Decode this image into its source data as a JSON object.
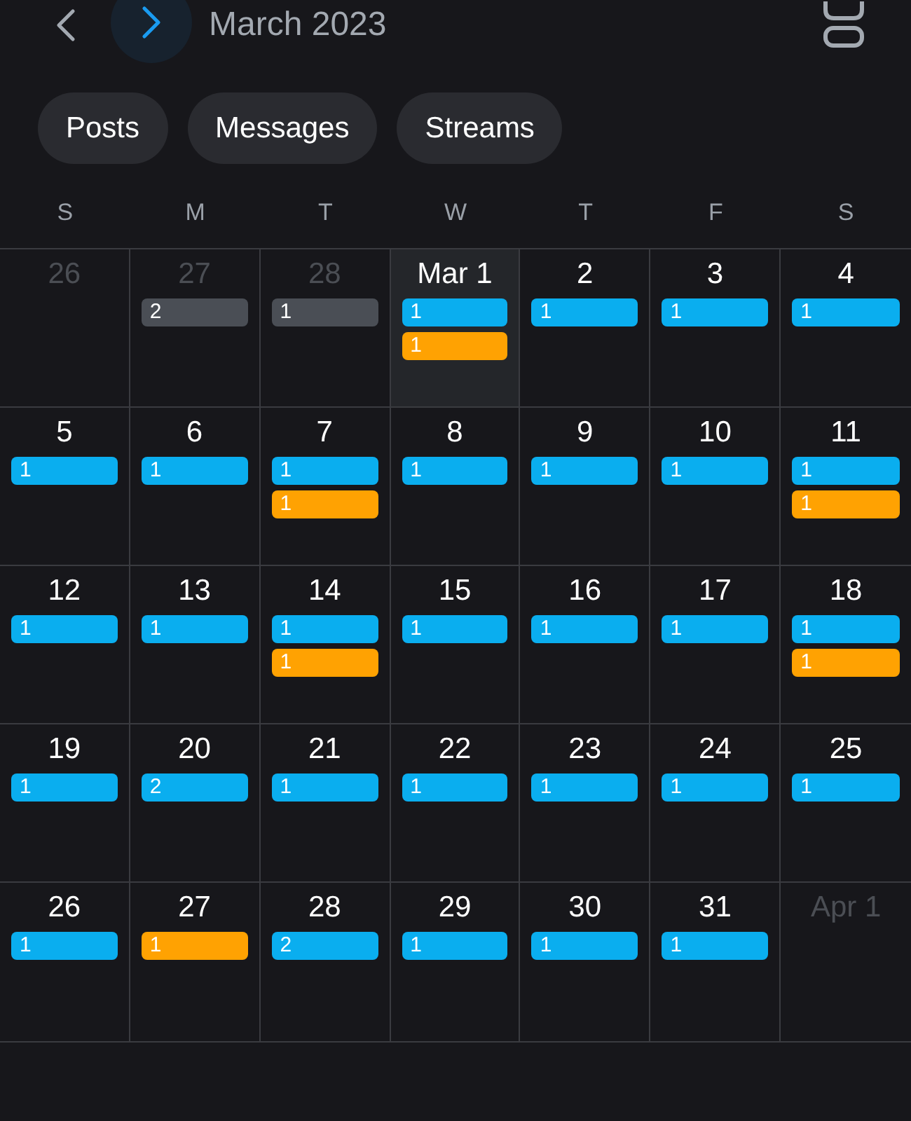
{
  "header": {
    "title": "March 2023"
  },
  "filters": [
    {
      "label": "Posts"
    },
    {
      "label": "Messages"
    },
    {
      "label": "Streams"
    }
  ],
  "weekdays": [
    "S",
    "M",
    "T",
    "W",
    "T",
    "F",
    "S"
  ],
  "weeks": [
    {
      "days": [
        {
          "label": "26",
          "in_month": false,
          "selected": false
        },
        {
          "label": "27",
          "in_month": false,
          "selected": false,
          "events": [
            {
              "count": "2",
              "color": "#4a4e55"
            }
          ]
        },
        {
          "label": "28",
          "in_month": false,
          "selected": false,
          "events": [
            {
              "count": "1",
              "color": "#4a4e55"
            }
          ]
        },
        {
          "label": "Mar 1",
          "in_month": true,
          "selected": true,
          "events": [
            {
              "count": "1",
              "color": "#0aaeef"
            },
            {
              "count": "1",
              "color": "#ffa202"
            }
          ]
        },
        {
          "label": "2",
          "in_month": true,
          "selected": false,
          "events": [
            {
              "count": "1",
              "color": "#0aaeef"
            }
          ]
        },
        {
          "label": "3",
          "in_month": true,
          "selected": false,
          "events": [
            {
              "count": "1",
              "color": "#0aaeef"
            }
          ]
        },
        {
          "label": "4",
          "in_month": true,
          "selected": false,
          "events": [
            {
              "count": "1",
              "color": "#0aaeef"
            }
          ]
        }
      ]
    },
    {
      "days": [
        {
          "label": "5",
          "in_month": true,
          "selected": false,
          "events": [
            {
              "count": "1",
              "color": "#0aaeef"
            }
          ]
        },
        {
          "label": "6",
          "in_month": true,
          "selected": false,
          "events": [
            {
              "count": "1",
              "color": "#0aaeef"
            }
          ]
        },
        {
          "label": "7",
          "in_month": true,
          "selected": false,
          "events": [
            {
              "count": "1",
              "color": "#0aaeef"
            },
            {
              "count": "1",
              "color": "#ffa202"
            }
          ]
        },
        {
          "label": "8",
          "in_month": true,
          "selected": false,
          "events": [
            {
              "count": "1",
              "color": "#0aaeef"
            }
          ]
        },
        {
          "label": "9",
          "in_month": true,
          "selected": false,
          "events": [
            {
              "count": "1",
              "color": "#0aaeef"
            }
          ]
        },
        {
          "label": "10",
          "in_month": true,
          "selected": false,
          "events": [
            {
              "count": "1",
              "color": "#0aaeef"
            }
          ]
        },
        {
          "label": "11",
          "in_month": true,
          "selected": false,
          "events": [
            {
              "count": "1",
              "color": "#0aaeef"
            },
            {
              "count": "1",
              "color": "#ffa202"
            }
          ]
        }
      ]
    },
    {
      "days": [
        {
          "label": "12",
          "in_month": true,
          "selected": false,
          "events": [
            {
              "count": "1",
              "color": "#0aaeef"
            }
          ]
        },
        {
          "label": "13",
          "in_month": true,
          "selected": false,
          "events": [
            {
              "count": "1",
              "color": "#0aaeef"
            }
          ]
        },
        {
          "label": "14",
          "in_month": true,
          "selected": false,
          "events": [
            {
              "count": "1",
              "color": "#0aaeef"
            },
            {
              "count": "1",
              "color": "#ffa202"
            }
          ]
        },
        {
          "label": "15",
          "in_month": true,
          "selected": false,
          "events": [
            {
              "count": "1",
              "color": "#0aaeef"
            }
          ]
        },
        {
          "label": "16",
          "in_month": true,
          "selected": false,
          "events": [
            {
              "count": "1",
              "color": "#0aaeef"
            }
          ]
        },
        {
          "label": "17",
          "in_month": true,
          "selected": false,
          "events": [
            {
              "count": "1",
              "color": "#0aaeef"
            }
          ]
        },
        {
          "label": "18",
          "in_month": true,
          "selected": false,
          "events": [
            {
              "count": "1",
              "color": "#0aaeef"
            },
            {
              "count": "1",
              "color": "#ffa202"
            }
          ]
        }
      ]
    },
    {
      "days": [
        {
          "label": "19",
          "in_month": true,
          "selected": false,
          "events": [
            {
              "count": "1",
              "color": "#0aaeef"
            }
          ]
        },
        {
          "label": "20",
          "in_month": true,
          "selected": false,
          "events": [
            {
              "count": "2",
              "color": "#0aaeef"
            }
          ]
        },
        {
          "label": "21",
          "in_month": true,
          "selected": false,
          "events": [
            {
              "count": "1",
              "color": "#0aaeef"
            }
          ]
        },
        {
          "label": "22",
          "in_month": true,
          "selected": false,
          "events": [
            {
              "count": "1",
              "color": "#0aaeef"
            }
          ]
        },
        {
          "label": "23",
          "in_month": true,
          "selected": false,
          "events": [
            {
              "count": "1",
              "color": "#0aaeef"
            }
          ]
        },
        {
          "label": "24",
          "in_month": true,
          "selected": false,
          "events": [
            {
              "count": "1",
              "color": "#0aaeef"
            }
          ]
        },
        {
          "label": "25",
          "in_month": true,
          "selected": false,
          "events": [
            {
              "count": "1",
              "color": "#0aaeef"
            }
          ]
        }
      ]
    },
    {
      "days": [
        {
          "label": "26",
          "in_month": true,
          "selected": false,
          "events": [
            {
              "count": "1",
              "color": "#0aaeef"
            }
          ]
        },
        {
          "label": "27",
          "in_month": true,
          "selected": false,
          "events": [
            {
              "count": "1",
              "color": "#ffa202"
            }
          ]
        },
        {
          "label": "28",
          "in_month": true,
          "selected": false,
          "events": [
            {
              "count": "2",
              "color": "#0aaeef"
            }
          ]
        },
        {
          "label": "29",
          "in_month": true,
          "selected": false,
          "events": [
            {
              "count": "1",
              "color": "#0aaeef"
            }
          ]
        },
        {
          "label": "30",
          "in_month": true,
          "selected": false,
          "events": [
            {
              "count": "1",
              "color": "#0aaeef"
            }
          ]
        },
        {
          "label": "31",
          "in_month": true,
          "selected": false,
          "events": [
            {
              "count": "1",
              "color": "#0aaeef"
            }
          ]
        },
        {
          "label": "Apr 1",
          "in_month": false,
          "selected": false
        }
      ]
    }
  ]
}
